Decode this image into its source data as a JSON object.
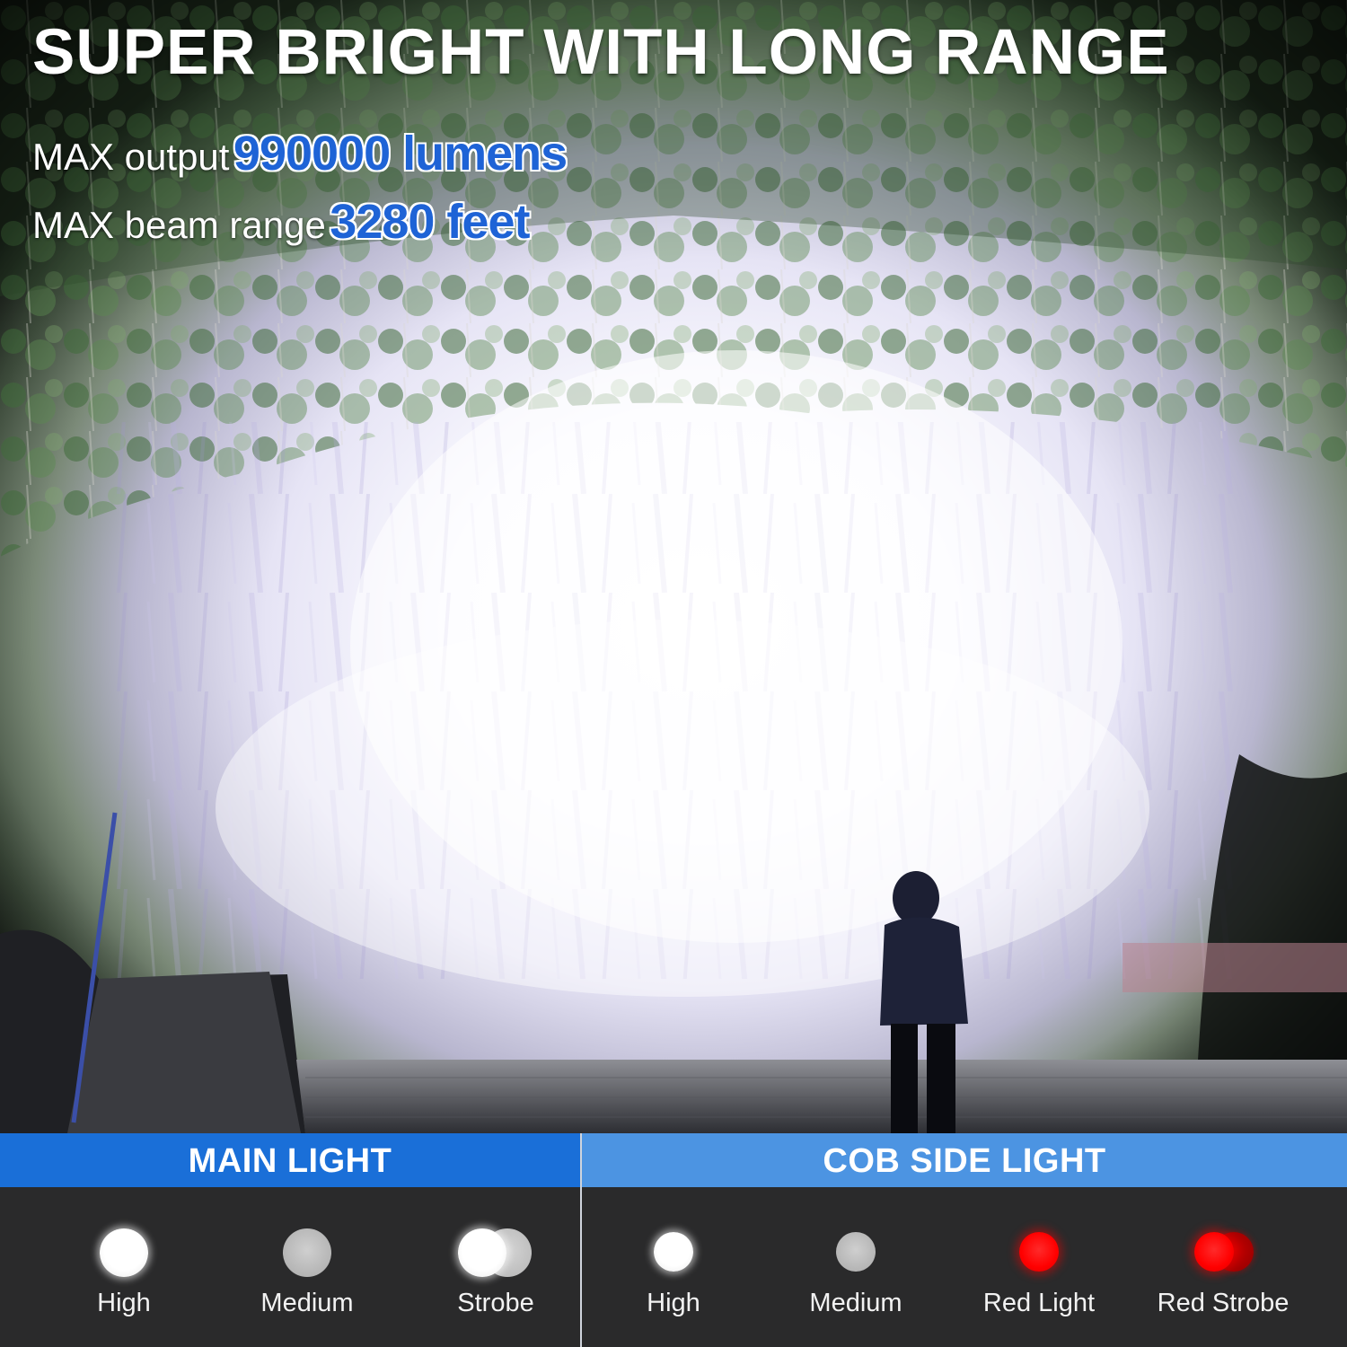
{
  "headline": "SUPER BRIGHT WITH LONG RANGE",
  "specs": [
    {
      "label": "MAX output",
      "value": "990000 lumens"
    },
    {
      "label": "MAX beam range",
      "value": "3280 feet"
    }
  ],
  "scene": {
    "description_icon": "flashlight-beam-scene",
    "beam_color": "#ffffff"
  },
  "sections": {
    "main": {
      "title": "MAIN LIGHT",
      "header_color": "#1a6fd8",
      "modes": [
        {
          "label": "High",
          "icon": "white-light-dot"
        },
        {
          "label": "Medium",
          "icon": "gray-light-dot"
        },
        {
          "label": "Strobe",
          "icon": "white-strobe-dots"
        }
      ]
    },
    "cob": {
      "title": "COB SIDE LIGHT",
      "header_color": "#4c94e2",
      "modes": [
        {
          "label": "High",
          "icon": "white-light-dot"
        },
        {
          "label": "Medium",
          "icon": "gray-light-dot"
        },
        {
          "label": "Red Light",
          "icon": "red-light-dot"
        },
        {
          "label": "Red Strobe",
          "icon": "red-strobe-dots"
        }
      ]
    }
  }
}
